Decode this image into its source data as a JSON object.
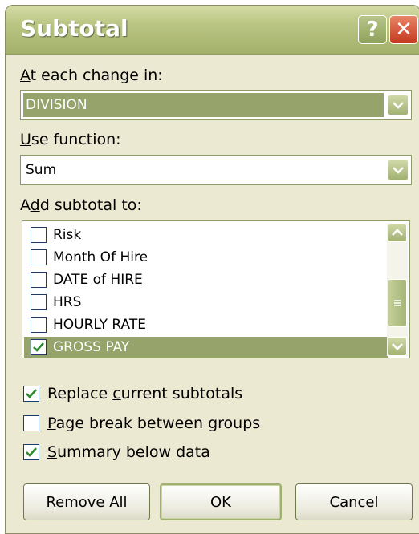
{
  "dialog": {
    "title": "Subtotal",
    "help_glyph": "?",
    "close_glyph": "✕"
  },
  "change_in": {
    "label_mnemonic": "A",
    "label_rest": "t each change in:",
    "value": "DIVISION"
  },
  "function": {
    "label_mnemonic": "U",
    "label_rest": "se function:",
    "value": "Sum"
  },
  "add_subtotal": {
    "label_pre": "A",
    "label_mnemonic": "d",
    "label_rest": "d subtotal to:",
    "items": [
      {
        "label": "Risk",
        "checked": false,
        "selected": false
      },
      {
        "label": "Month Of Hire",
        "checked": false,
        "selected": false
      },
      {
        "label": "DATE of HIRE",
        "checked": false,
        "selected": false
      },
      {
        "label": "HRS",
        "checked": false,
        "selected": false
      },
      {
        "label": "HOURLY RATE",
        "checked": false,
        "selected": false
      },
      {
        "label": "GROSS PAY",
        "checked": true,
        "selected": true
      }
    ]
  },
  "options": {
    "replace": {
      "pre": "Replace ",
      "mnemonic": "c",
      "rest": "urrent subtotals",
      "checked": true
    },
    "page_break": {
      "pre": "",
      "mnemonic": "P",
      "rest": "age break between groups",
      "checked": false
    },
    "summary": {
      "pre": "",
      "mnemonic": "S",
      "rest": "ummary below data",
      "checked": true
    }
  },
  "buttons": {
    "remove_mnemonic": "R",
    "remove_rest": "emove All",
    "ok": "OK",
    "cancel": "Cancel"
  },
  "colors": {
    "theme_olive": "#96a36a",
    "dialog_bg": "#ece9d2",
    "close_red": "#c4391e",
    "check_green": "#2d8a2d"
  },
  "icons": {
    "dropdown": "chevron-down-icon",
    "scroll_up": "chevron-up-icon",
    "scroll_down": "chevron-down-icon",
    "check": "check-icon"
  }
}
